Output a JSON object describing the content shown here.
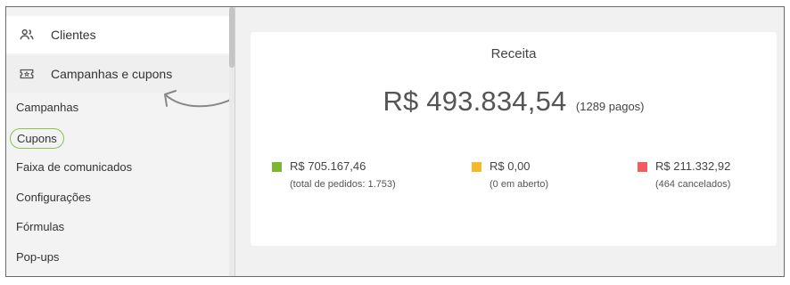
{
  "sidebar": {
    "items": [
      {
        "label": "Clientes",
        "icon": "users-icon"
      },
      {
        "label": "Campanhas e cupons",
        "icon": "ticket-icon"
      }
    ],
    "subitems": [
      {
        "label": "Campanhas"
      },
      {
        "label": "Cupons",
        "highlighted": true
      },
      {
        "label": "Faixa de comunicados"
      },
      {
        "label": "Configurações"
      },
      {
        "label": "Fórmulas"
      },
      {
        "label": "Pop-ups"
      }
    ]
  },
  "revenue": {
    "title": "Receita",
    "total": "R$ 493.834,54",
    "paid": "(1289 pagos)",
    "stats": [
      {
        "value": "R$ 705.167,46",
        "sub": "(total de pedidos: 1.753)",
        "color": "#7cb82f"
      },
      {
        "value": "R$ 0,00",
        "sub": "(0 em aberto)",
        "color": "#f6b92b"
      },
      {
        "value": "R$ 211.332,92",
        "sub": "(464 cancelados)",
        "color": "#f25c5c"
      }
    ]
  },
  "colors": {
    "highlight_ring": "#8bc34a"
  }
}
